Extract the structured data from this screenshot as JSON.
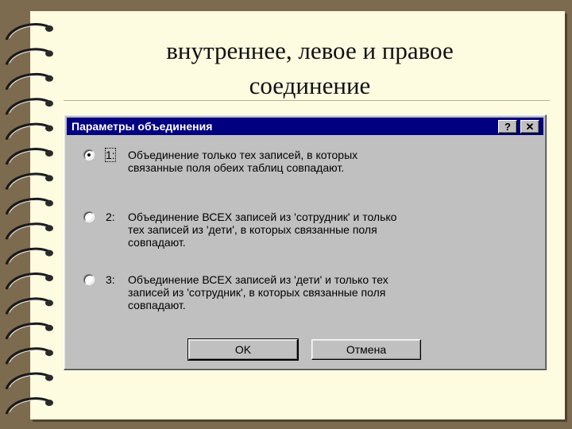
{
  "slide": {
    "title_line1": "внутреннее, левое и правое",
    "title_line2": "соединение"
  },
  "dialog": {
    "title": "Параметры объединения",
    "help_label": "?",
    "close_label": "✕",
    "options": [
      {
        "num": "1:",
        "text": "Объединение только тех записей, в которых\nсвязанные поля обеих таблиц совпадают.",
        "selected": true
      },
      {
        "num": "2:",
        "text": "Объединение ВСЕХ записей из 'сотрудник' и только\nтех записей из 'дети', в которых связанные поля\nсовпадают.",
        "selected": false
      },
      {
        "num": "3:",
        "text": "Объединение ВСЕХ записей из 'дети' и только тех\nзаписей из 'сотрудник', в которых связанные поля\nсовпадают.",
        "selected": false
      }
    ],
    "ok_label": "OK",
    "cancel_label": "Отмена"
  },
  "decor": {
    "spiral_icon": "spiral-binding"
  }
}
